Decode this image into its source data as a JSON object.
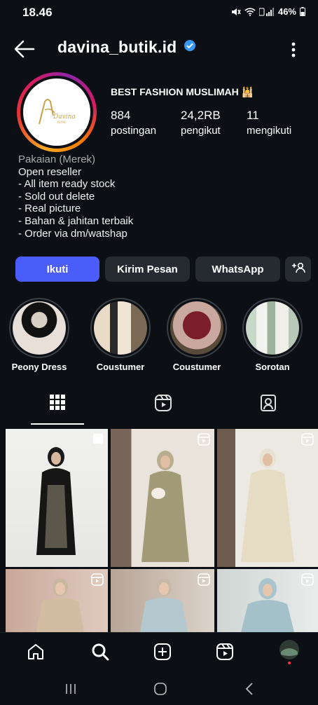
{
  "status_bar": {
    "time": "18.46",
    "battery": "46%"
  },
  "header": {
    "username": "davina_butik.id"
  },
  "profile": {
    "display_name": "BEST FASHION MUSLIMAH 🕌",
    "stats": [
      {
        "value": "884",
        "label": "postingan"
      },
      {
        "value": "24,2RB",
        "label": "pengikut"
      },
      {
        "value": "11",
        "label": "mengikuti"
      }
    ],
    "category": "Pakaian (Merek)",
    "bio_lines": [
      "Open reseller",
      "- All item ready stock",
      "- Sold out delete",
      "- Real picture",
      "- Bahan & jahitan terbaik",
      "- Order via dm/watshap"
    ]
  },
  "buttons": {
    "follow": "Ikuti",
    "message": "Kirim Pesan",
    "whatsapp": "WhatsApp",
    "suggest": "+ዳ"
  },
  "highlights": [
    {
      "label": "Peony Dress"
    },
    {
      "label": "Coustumer"
    },
    {
      "label": "Coustumer"
    },
    {
      "label": "Sorotan"
    }
  ],
  "colors": {
    "background": "#0c1014",
    "follow_button": "#4a5df9",
    "secondary_button": "#262b31",
    "verified_badge": "#3897f0"
  },
  "grid_tiles": [
    {
      "indicator": "multi-icon"
    },
    {
      "indicator": "reel-icon"
    },
    {
      "indicator": "reel-icon"
    },
    {
      "indicator": "reel-icon"
    },
    {
      "indicator": "reel-icon"
    },
    {
      "indicator": "reel-icon"
    }
  ]
}
